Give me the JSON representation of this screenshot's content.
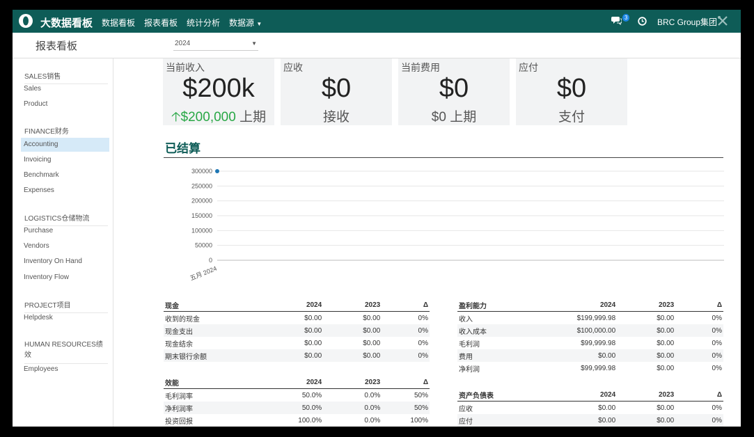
{
  "topbar": {
    "app_title": "大数据看板",
    "nav": [
      "数据看板",
      "报表看板",
      "统计分析",
      "数据源"
    ],
    "message_count": "3",
    "company": "BRC Group集团"
  },
  "subheader": {
    "title": "报表看板",
    "year": "2024"
  },
  "sidebar": {
    "groups": [
      {
        "head": "SALES销售",
        "items": [
          "Sales",
          "Product"
        ]
      },
      {
        "head": "FINANCE财务",
        "items": [
          "Accounting",
          "Invoicing",
          "Benchmark",
          "Expenses"
        ]
      },
      {
        "head": "LOGISTICS仓储物流",
        "items": [
          "Purchase",
          "Vendors",
          "Inventory On Hand",
          "Inventory Flow"
        ]
      },
      {
        "head": "PROJECT项目",
        "items": [
          "Helpdesk"
        ]
      },
      {
        "head": "HUMAN RESOURCES绩效",
        "items": [
          "Employees"
        ]
      }
    ],
    "active": "Accounting"
  },
  "kpis": [
    {
      "title": "当前收入",
      "value": "$200k",
      "sub_value": "$200,000",
      "sub_label": "上期"
    },
    {
      "title": "应收",
      "value": "$0",
      "sub_label": "接收"
    },
    {
      "title": "当前费用",
      "value": "$0",
      "sub_label": "$0 上期"
    },
    {
      "title": "应付",
      "value": "$0",
      "sub_label": "支付"
    }
  ],
  "section": {
    "title": "已结算"
  },
  "chart_data": {
    "type": "line",
    "x": [
      "五月 2024"
    ],
    "series": [
      {
        "values": [
          300000
        ]
      }
    ],
    "yticks": [
      "300000",
      "250000",
      "200000",
      "150000",
      "100000",
      "50000",
      "0"
    ],
    "ylim": [
      0,
      300000
    ],
    "grid": true,
    "color": "#1f77b4"
  },
  "tables": {
    "cash": {
      "headers": [
        "现金",
        "2024",
        "2023",
        "Δ"
      ],
      "rows": [
        [
          "收到的现金",
          "$0.00",
          "$0.00",
          "0%"
        ],
        [
          "现金支出",
          "$0.00",
          "$0.00",
          "0%"
        ],
        [
          "现金结余",
          "$0.00",
          "$0.00",
          "0%"
        ],
        [
          "期末银行余额",
          "$0.00",
          "$0.00",
          "0%"
        ]
      ]
    },
    "efficiency": {
      "headers": [
        "效能",
        "2024",
        "2023",
        "Δ"
      ],
      "rows": [
        [
          "毛利润率",
          "50.0%",
          "0.0%",
          "50%"
        ],
        [
          "净利润率",
          "50.0%",
          "0.0%",
          "50%"
        ],
        [
          "投资回报",
          "100.0%",
          "0.0%",
          "100%"
        ]
      ]
    },
    "profitability": {
      "headers": [
        "盈利能力",
        "2024",
        "2023",
        "Δ"
      ],
      "rows": [
        [
          "收入",
          "$199,999.98",
          "$0.00",
          "0%"
        ],
        [
          "收入成本",
          "$100,000.00",
          "$0.00",
          "0%"
        ],
        [
          "毛利润",
          "$99,999.98",
          "$0.00",
          "0%"
        ],
        [
          "费用",
          "$0.00",
          "$0.00",
          "0%"
        ],
        [
          "净利润",
          "$99,999.98",
          "$0.00",
          "0%"
        ]
      ]
    },
    "balance": {
      "headers": [
        "资产负债表",
        "2024",
        "2023",
        "Δ"
      ],
      "rows": [
        [
          "应收",
          "$0.00",
          "$0.00",
          "0%"
        ],
        [
          "应付",
          "$0.00",
          "$0.00",
          "0%"
        ]
      ]
    }
  },
  "icons": {
    "logo": "app-logo",
    "messages": "chat-icon",
    "activity": "clock-icon",
    "settings": "tools-icon"
  }
}
